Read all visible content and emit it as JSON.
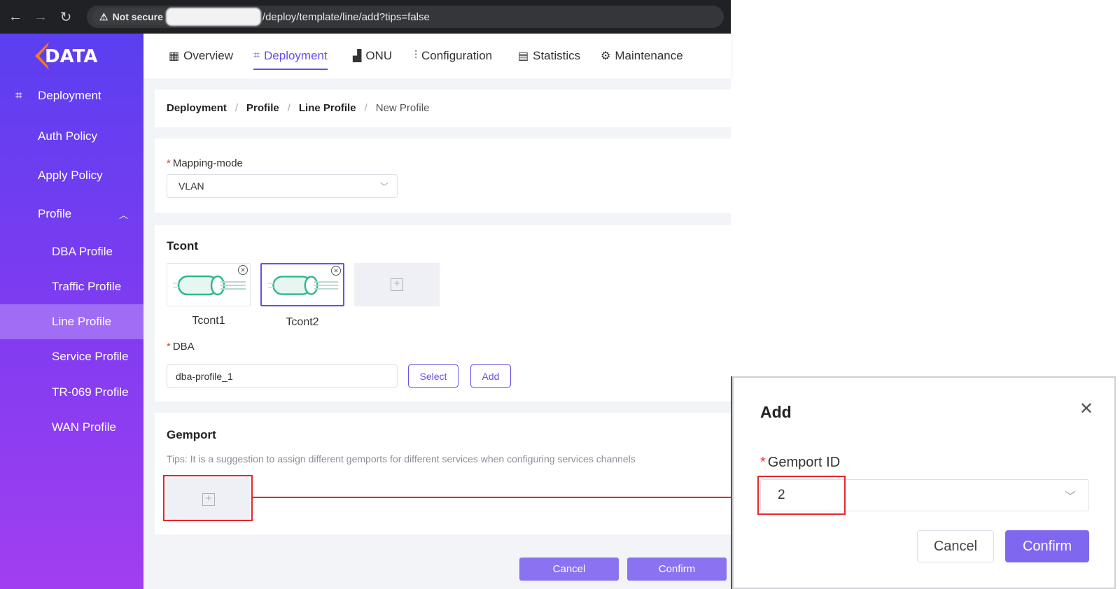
{
  "browser": {
    "security_label": "Not secure",
    "url_path": "/deploy/template/line/add?tips=false"
  },
  "brand": {
    "logo_text": "C-DATA"
  },
  "sidebar": {
    "section_label": "Deployment",
    "items": [
      {
        "label": "Auth Policy"
      },
      {
        "label": "Apply Policy"
      },
      {
        "label": "Profile"
      },
      {
        "label": "DBA Profile"
      },
      {
        "label": "Traffic Profile"
      },
      {
        "label": "Line Profile"
      },
      {
        "label": "Service Profile"
      },
      {
        "label": "TR-069 Profile"
      },
      {
        "label": "WAN Profile"
      }
    ]
  },
  "topnav": {
    "items": [
      {
        "label": "Overview",
        "icon": "grid-icon"
      },
      {
        "label": "Deployment",
        "icon": "nodes-icon",
        "active": true
      },
      {
        "label": "ONU",
        "icon": "onu-icon"
      },
      {
        "label": "Configuration",
        "icon": "sliders-icon"
      },
      {
        "label": "Statistics",
        "icon": "window-icon"
      },
      {
        "label": "Maintenance",
        "icon": "gear-icon"
      }
    ]
  },
  "breadcrumb": [
    "Deployment",
    "Profile",
    "Line Profile",
    "New Profile"
  ],
  "form": {
    "mapping_mode_label": "Mapping-mode",
    "mapping_mode_value": "VLAN",
    "tcont_title": "Tcont",
    "tconts": [
      {
        "name": "Tcont1"
      },
      {
        "name": "Tcont2"
      }
    ],
    "dba_label": "DBA",
    "dba_value": "dba-profile_1",
    "select_button": "Select",
    "add_button": "Add",
    "gemport_title": "Gemport",
    "gemport_tips": "Tips: It is a suggestion to assign different gemports for different services when configuring services channels",
    "cancel_button": "Cancel",
    "confirm_button": "Confirm"
  },
  "dialog": {
    "title": "Add",
    "gemport_label": "Gemport ID",
    "gemport_value": "2",
    "cancel_button": "Cancel",
    "confirm_button": "Confirm"
  },
  "colors": {
    "accent": "#6b4dea",
    "sidebar_top": "#5b3ff0",
    "sidebar_bottom": "#a13ef1",
    "highlight": "#e8262a"
  }
}
